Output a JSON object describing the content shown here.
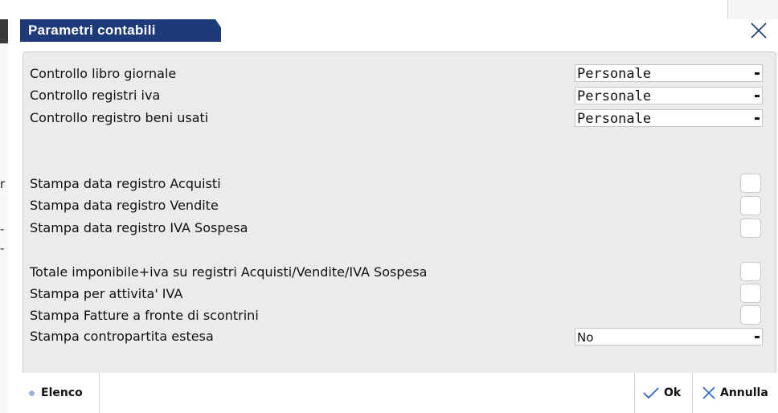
{
  "background": {
    "fragments": [
      "r",
      "-",
      "-"
    ]
  },
  "dialog": {
    "title": "Parametri contabili",
    "close_icon": "close-x-icon",
    "combos": [
      {
        "label": "Controllo libro giornale",
        "value": "Personale"
      },
      {
        "label": "Controllo registri iva",
        "value": "Personale"
      },
      {
        "label": "Controllo registro beni usati",
        "value": "Personale"
      }
    ],
    "checks_group1": [
      {
        "label": "Stampa data registro Acquisti",
        "checked": false
      },
      {
        "label": "Stampa data registro Vendite",
        "checked": false
      },
      {
        "label": "Stampa data registro IVA Sospesa",
        "checked": false
      }
    ],
    "checks_group2": [
      {
        "label": "Totale imponibile+iva su registri Acquisti/Vendite/IVA Sospesa",
        "checked": false
      },
      {
        "label": "Stampa per attivita' IVA",
        "checked": false
      },
      {
        "label": "Stampa Fatture a fronte di scontrini",
        "checked": false
      }
    ],
    "extended": {
      "label": "Stampa contropartita estesa",
      "value": "No"
    }
  },
  "footer": {
    "elenco_label": "Elenco",
    "ok_label": "Ok",
    "annulla_label": "Annulla"
  },
  "colors": {
    "title_bg": "#1e3a78",
    "accent_blue": "#2f62c4"
  }
}
